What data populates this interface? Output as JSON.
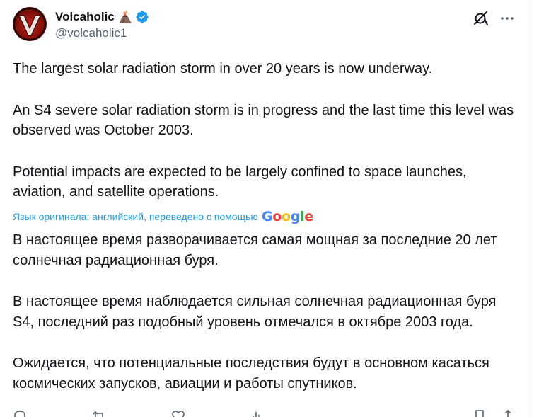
{
  "author": {
    "display_name": "Volcaholic",
    "emoji": "volcano-emoji",
    "handle": "@volcaholic1",
    "verified": true,
    "verified_color": "#1d9bf0"
  },
  "header_actions": {
    "grok": "grok-icon",
    "more": "more-icon"
  },
  "tweet": {
    "paragraphs": [
      "The largest solar radiation storm in over 20 years is now underway.",
      "An S4 severe solar radiation storm is in progress and the last time this level was observed was October 2003.",
      "Potential impacts are expected to be largely confined to space launches, aviation, and satellite operations."
    ]
  },
  "translation": {
    "note": "Язык оригинала: английский, переведено с помощью",
    "provider": "Google",
    "paragraphs": [
      "В настоящее время разворачивается самая мощная за последние 20 лет солнечная радиационная буря.",
      "В настоящее время наблюдается сильная солнечная радиационная буря S4, последний раз подобный уровень отмечался в октябре 2003 года.",
      "Ожидается, что потенциальные последствия будут в основном касаться космических запусков, авиации и работы спутников."
    ]
  },
  "actions": [
    "reply-icon",
    "retweet-icon",
    "like-icon",
    "views-icon",
    "bookmark-icon",
    "share-icon"
  ],
  "colors": {
    "text": "#0f1419",
    "secondary": "#536471",
    "link": "#1d9bf0"
  }
}
